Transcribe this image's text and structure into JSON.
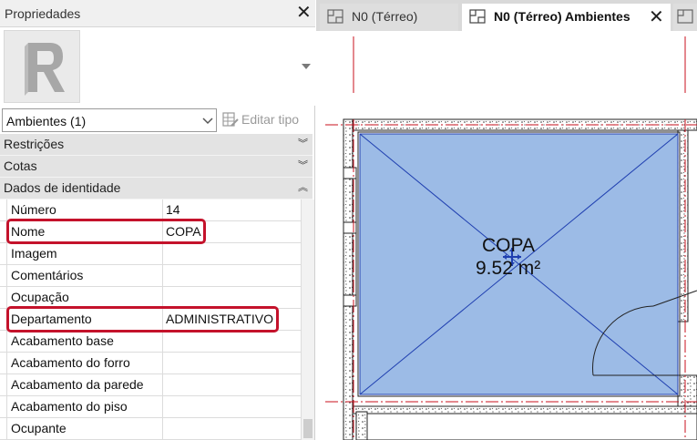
{
  "properties_panel": {
    "title": "Propriedades",
    "type_selector": {
      "value": "Ambientes (1)"
    },
    "edit_type_label": "Editar tipo",
    "sections": [
      {
        "label": "Restrições",
        "state": "collapsed"
      },
      {
        "label": "Cotas",
        "state": "collapsed"
      },
      {
        "label": "Dados de identidade",
        "state": "expanded"
      }
    ],
    "rows": [
      {
        "name": "Número",
        "value": "14"
      },
      {
        "name": "Nome",
        "value": "COPA",
        "highlighted": true
      },
      {
        "name": "Imagem",
        "value": ""
      },
      {
        "name": "Comentários",
        "value": ""
      },
      {
        "name": "Ocupação",
        "value": ""
      },
      {
        "name": "Departamento",
        "value": "ADMINISTRATIVO",
        "highlighted": true
      },
      {
        "name": "Acabamento base",
        "value": ""
      },
      {
        "name": "Acabamento do forro",
        "value": ""
      },
      {
        "name": "Acabamento da parede",
        "value": ""
      },
      {
        "name": "Acabamento do piso",
        "value": ""
      },
      {
        "name": "Ocupante",
        "value": ""
      }
    ],
    "highlight_color": "#c4122b"
  },
  "tabs": [
    {
      "label": "N0 (Térreo)",
      "active": false
    },
    {
      "label": "N0 (Térreo) Ambientes",
      "active": true
    }
  ],
  "room": {
    "name": "COPA",
    "area": "9.52 m²",
    "fill_color": "#9cbbe6",
    "line_color": "#1f3fb0"
  },
  "colors": {
    "grid_red": "#c8101e",
    "section_header_bg": "#e3e3e3",
    "tabbar_bg": "#d9d9d9"
  }
}
